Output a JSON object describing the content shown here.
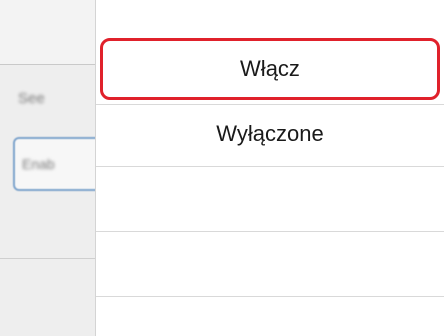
{
  "background": {
    "label": "See",
    "field_value": "Enab"
  },
  "popup": {
    "options": [
      {
        "label": "Włącz",
        "selected": true
      },
      {
        "label": "Wyłączone",
        "selected": false
      }
    ],
    "empty_rows": 3
  },
  "colors": {
    "selected_border": "#e0212b",
    "field_border": "#7ea4cc"
  }
}
